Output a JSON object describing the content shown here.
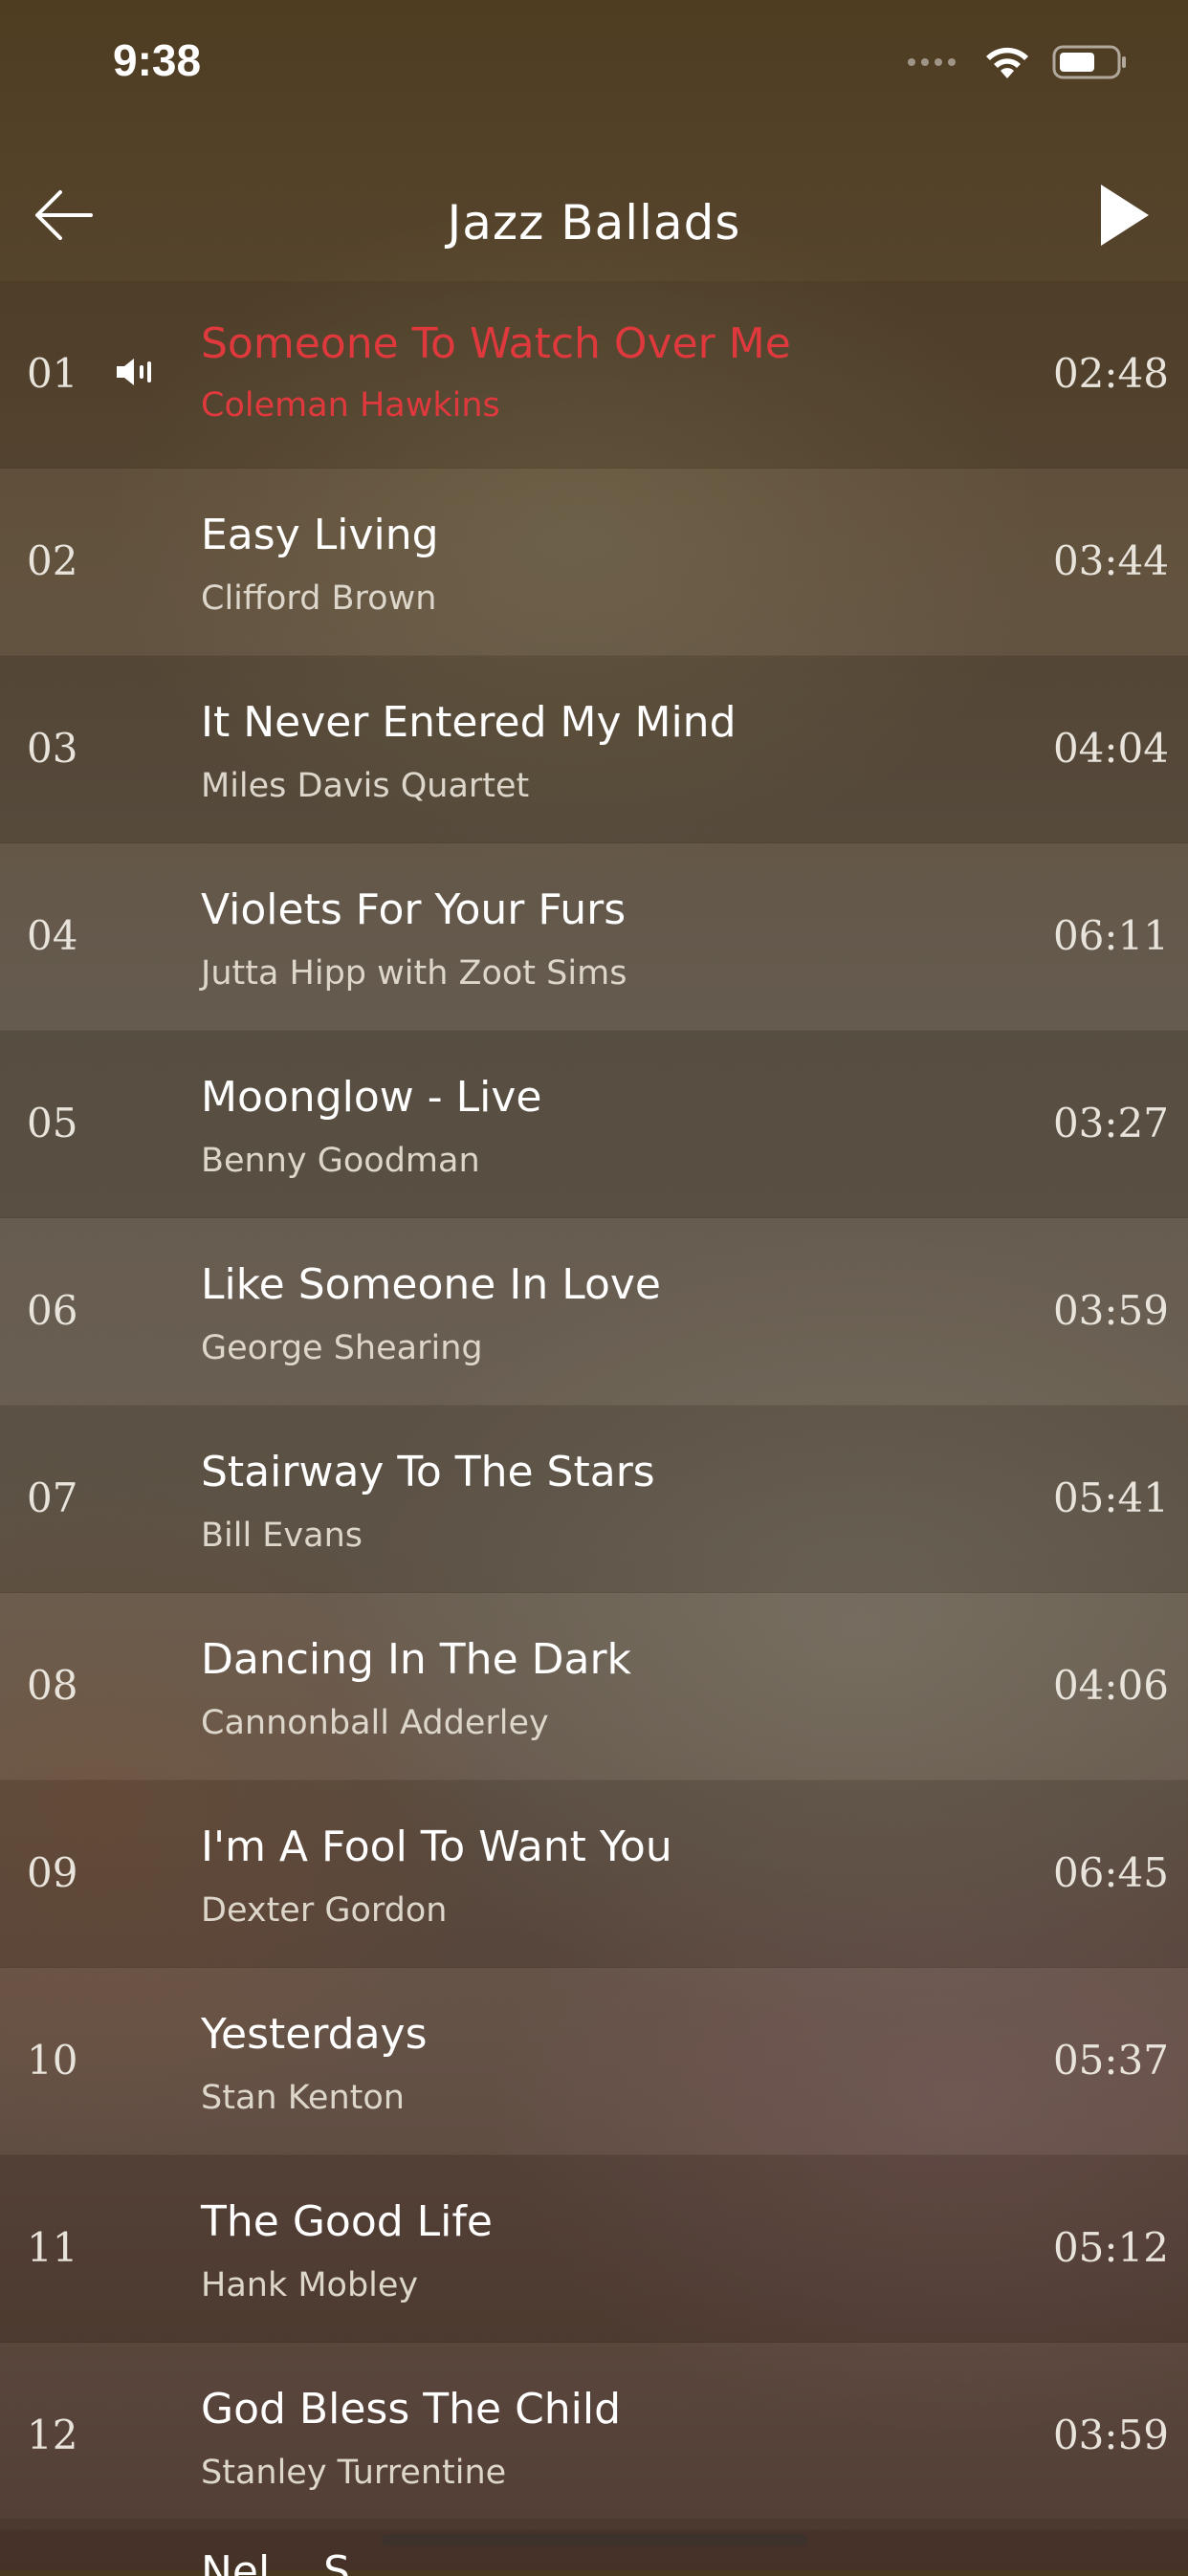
{
  "status_bar": {
    "time": "9:38"
  },
  "nav": {
    "title": "Jazz Ballads"
  },
  "tracks": [
    {
      "num": "01",
      "title": "Someone To Watch Over Me",
      "artist": "Coleman Hawkins",
      "duration": "02:48",
      "playing": true
    },
    {
      "num": "02",
      "title": "Easy Living",
      "artist": "Clifford Brown",
      "duration": "03:44"
    },
    {
      "num": "03",
      "title": "It Never Entered My Mind",
      "artist": "Miles Davis Quartet",
      "duration": "04:04"
    },
    {
      "num": "04",
      "title": "Violets For Your Furs",
      "artist": "Jutta Hipp with Zoot Sims",
      "duration": "06:11"
    },
    {
      "num": "05",
      "title": "Moonglow - Live",
      "artist": "Benny Goodman",
      "duration": "03:27"
    },
    {
      "num": "06",
      "title": "Like Someone In Love",
      "artist": "George Shearing",
      "duration": "03:59"
    },
    {
      "num": "07",
      "title": "Stairway To The Stars",
      "artist": "Bill Evans",
      "duration": "05:41"
    },
    {
      "num": "08",
      "title": "Dancing In The Dark",
      "artist": "Cannonball Adderley",
      "duration": "04:06"
    },
    {
      "num": "09",
      "title": "I'm A Fool To Want You",
      "artist": "Dexter Gordon",
      "duration": "06:45"
    },
    {
      "num": "10",
      "title": "Yesterdays",
      "artist": "Stan Kenton",
      "duration": "05:37"
    },
    {
      "num": "11",
      "title": "The Good Life",
      "artist": "Hank Mobley",
      "duration": "05:12"
    },
    {
      "num": "12",
      "title": "God Bless The Child",
      "artist": "Stanley Turrentine",
      "duration": "03:59"
    }
  ],
  "partial_track": {
    "title": "Nel... S..."
  },
  "colors": {
    "playing": "#e0393d"
  }
}
